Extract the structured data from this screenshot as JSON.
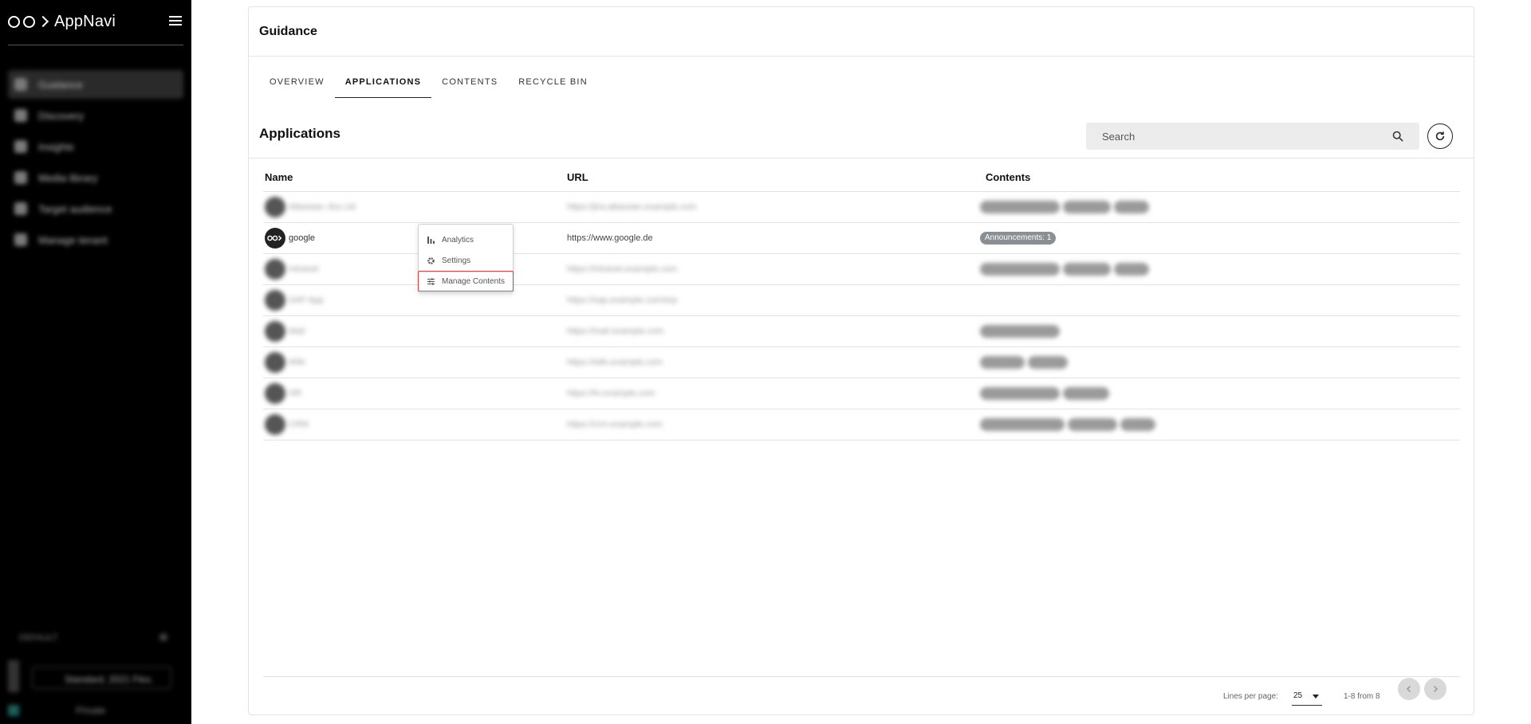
{
  "app": {
    "name": "AppNavi"
  },
  "sidebar": {
    "items": [
      {
        "label": "Guidance",
        "active": true
      },
      {
        "label": "Discovery"
      },
      {
        "label": "Insights"
      },
      {
        "label": "Media library"
      },
      {
        "label": "Target audience"
      },
      {
        "label": "Manage tenant"
      }
    ],
    "footer": {
      "label": "DEFAULT",
      "select": "Standard, 2021 Flex.",
      "bottom": "Private"
    }
  },
  "page": {
    "title": "Guidance"
  },
  "tabs": [
    {
      "label": "OVERVIEW"
    },
    {
      "label": "APPLICATIONS",
      "active": true
    },
    {
      "label": "CONTENTS"
    },
    {
      "label": "RECYCLE BIN"
    }
  ],
  "section": {
    "title": "Applications"
  },
  "search": {
    "placeholder": "Search",
    "value": ""
  },
  "table": {
    "headers": {
      "name": "Name",
      "url": "URL",
      "contents": "Contents"
    },
    "rows": [
      {
        "name": "Atlassian Jira Ltd",
        "url": "https://jira.atlassian.example.com",
        "contents": "",
        "blurred": true
      },
      {
        "name": "google",
        "url": "https://www.google.de",
        "contents": "Announcements: 1",
        "blurred": false
      },
      {
        "name": "Intranet",
        "url": "https://intranet.example.com",
        "contents": "",
        "blurred": true
      },
      {
        "name": "SAP App",
        "url": "https://sap.example.com/erp",
        "contents": "",
        "blurred": true
      },
      {
        "name": "Mail",
        "url": "https://mail.example.com",
        "contents": "",
        "blurred": true
      },
      {
        "name": "Wiki",
        "url": "https://wiki.example.com",
        "contents": "",
        "blurred": true
      },
      {
        "name": "HR",
        "url": "https://hr.example.com",
        "contents": "",
        "blurred": true
      },
      {
        "name": "CRM",
        "url": "https://crm.example.com",
        "contents": "",
        "blurred": true
      }
    ]
  },
  "context_menu": {
    "items": [
      {
        "label": "Analytics",
        "icon": "bar-chart-icon"
      },
      {
        "label": "Settings",
        "icon": "gear-icon"
      },
      {
        "label": "Manage Contents",
        "icon": "sliders-icon",
        "highlighted": true
      }
    ]
  },
  "pagination": {
    "lines_label": "Lines per page:",
    "lines_value": "25",
    "range": "1-8 from 8"
  },
  "colors": {
    "sidebar_bg": "#000000",
    "badge_bg": "#8a8f93",
    "highlight": "#e23a3a"
  }
}
